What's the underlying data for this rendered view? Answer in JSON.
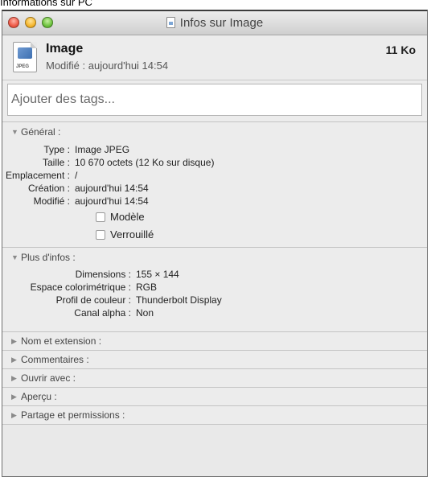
{
  "page_caption": "Informations sur PC",
  "window": {
    "title": "Infos sur Image"
  },
  "file": {
    "name": "Image",
    "modified": "Modifié : aujourd'hui 14:54",
    "size": "11 Ko",
    "icon_tag": "JPEG"
  },
  "tags": {
    "placeholder": "Ajouter des tags..."
  },
  "general": {
    "title": "Général :",
    "rows": [
      {
        "label": "Type :",
        "value": "Image JPEG"
      },
      {
        "label": "Taille :",
        "value": "10 670 octets (12 Ko sur disque)"
      },
      {
        "label": "Emplacement :",
        "value": "/"
      },
      {
        "label": "Création :",
        "value": "aujourd'hui 14:54"
      },
      {
        "label": "Modifié :",
        "value": "aujourd'hui 14:54"
      }
    ],
    "checkboxes": [
      {
        "label": "Modèle",
        "checked": false
      },
      {
        "label": "Verrouillé",
        "checked": false
      }
    ]
  },
  "more_info": {
    "title": "Plus d'infos :",
    "rows": [
      {
        "label": "Dimensions :",
        "value": "155 × 144"
      },
      {
        "label": "Espace colorimétrique :",
        "value": "RGB"
      },
      {
        "label": "Profil de couleur :",
        "value": "Thunderbolt Display"
      },
      {
        "label": "Canal alpha :",
        "value": "Non"
      }
    ]
  },
  "collapsed_sections": [
    {
      "title": "Nom et extension :"
    },
    {
      "title": "Commentaires :"
    },
    {
      "title": "Ouvrir avec :"
    },
    {
      "title": "Aperçu :"
    },
    {
      "title": "Partage et permissions :"
    }
  ],
  "icons": {
    "expanded": "disclosure-triangle-down-icon",
    "collapsed": "disclosure-triangle-right-icon"
  }
}
